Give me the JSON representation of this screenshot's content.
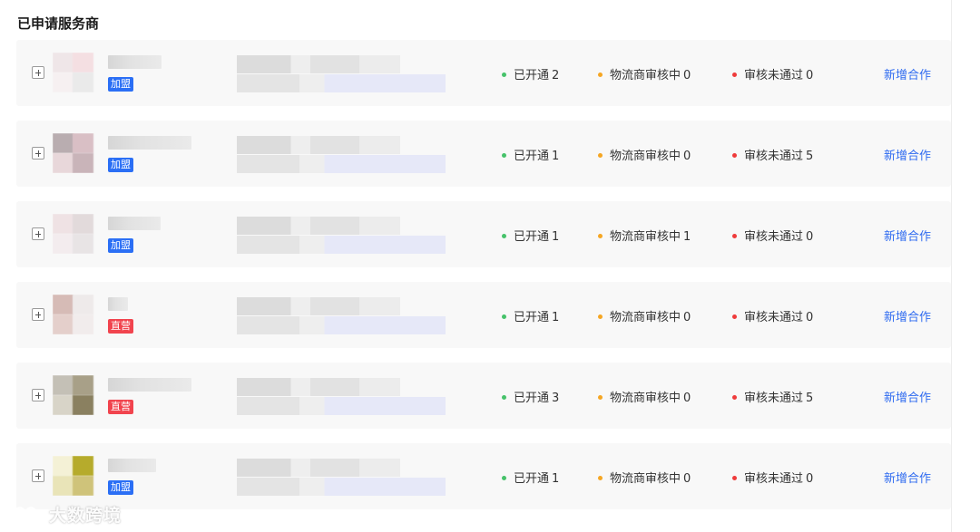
{
  "page": {
    "title": "已申请服务商"
  },
  "rows": [
    {
      "tag": "加盟",
      "tag_type": "join",
      "open_label": "已开通",
      "open_count": "2",
      "review_label": "物流商审核中",
      "review_count": "0",
      "fail_label": "审核未通过",
      "fail_count": "0",
      "action_label": "新增合作"
    },
    {
      "tag": "加盟",
      "tag_type": "join",
      "open_label": "已开通",
      "open_count": "1",
      "review_label": "物流商审核中",
      "review_count": "0",
      "fail_label": "审核未通过",
      "fail_count": "5",
      "action_label": "新增合作"
    },
    {
      "tag": "加盟",
      "tag_type": "join",
      "open_label": "已开通",
      "open_count": "1",
      "review_label": "物流商审核中",
      "review_count": "1",
      "fail_label": "审核未通过",
      "fail_count": "0",
      "action_label": "新增合作"
    },
    {
      "tag": "直营",
      "tag_type": "direct",
      "open_label": "已开通",
      "open_count": "1",
      "review_label": "物流商审核中",
      "review_count": "0",
      "fail_label": "审核未通过",
      "fail_count": "0",
      "action_label": "新增合作"
    },
    {
      "tag": "直营",
      "tag_type": "direct",
      "open_label": "已开通",
      "open_count": "3",
      "review_label": "物流商审核中",
      "review_count": "0",
      "fail_label": "审核未通过",
      "fail_count": "5",
      "action_label": "新增合作"
    },
    {
      "tag": "加盟",
      "tag_type": "join",
      "open_label": "已开通",
      "open_count": "1",
      "review_label": "物流商审核中",
      "review_count": "0",
      "fail_label": "审核未通过",
      "fail_count": "0",
      "action_label": "新增合作"
    }
  ],
  "colors": {
    "open_dot": "#46c26a",
    "review_dot": "#f5a623",
    "fail_dot": "#ef3b3b",
    "join_tag": "#2b6ff5",
    "direct_tag": "#f1444e",
    "action_link": "#2f6bf0"
  },
  "watermark": {
    "text": "大数跨境",
    "icon": "dashu-logo-icon"
  }
}
